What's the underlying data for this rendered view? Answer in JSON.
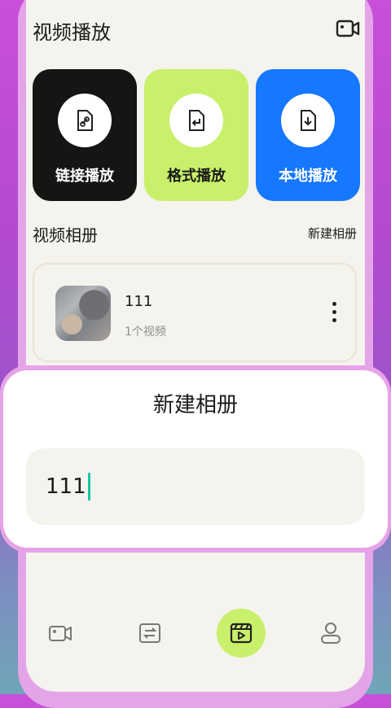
{
  "header": {
    "title": "视频播放",
    "action_icon": "video-camera-icon"
  },
  "tiles": [
    {
      "label": "链接播放",
      "icon": "link-file-icon",
      "bg": "#171513",
      "fg": "#ffffff"
    },
    {
      "label": "格式播放",
      "icon": "convert-file-icon",
      "bg": "#c8f06a",
      "fg": "#1a1a1a"
    },
    {
      "label": "本地播放",
      "icon": "download-file-icon",
      "bg": "#1677ff",
      "fg": "#ffffff"
    }
  ],
  "albums_section": {
    "title": "视频相册",
    "new_label": "新建相册",
    "items": [
      {
        "name": "111",
        "count": "1个视频"
      }
    ]
  },
  "dialog": {
    "title": "新建相册",
    "input_value": "111"
  },
  "tabbar": {
    "active_index": 2,
    "active_color": "#c8f06a",
    "items": [
      {
        "icon": "video-camera-icon"
      },
      {
        "icon": "swap-icon"
      },
      {
        "icon": "video-album-icon"
      },
      {
        "icon": "profile-icon"
      }
    ]
  }
}
